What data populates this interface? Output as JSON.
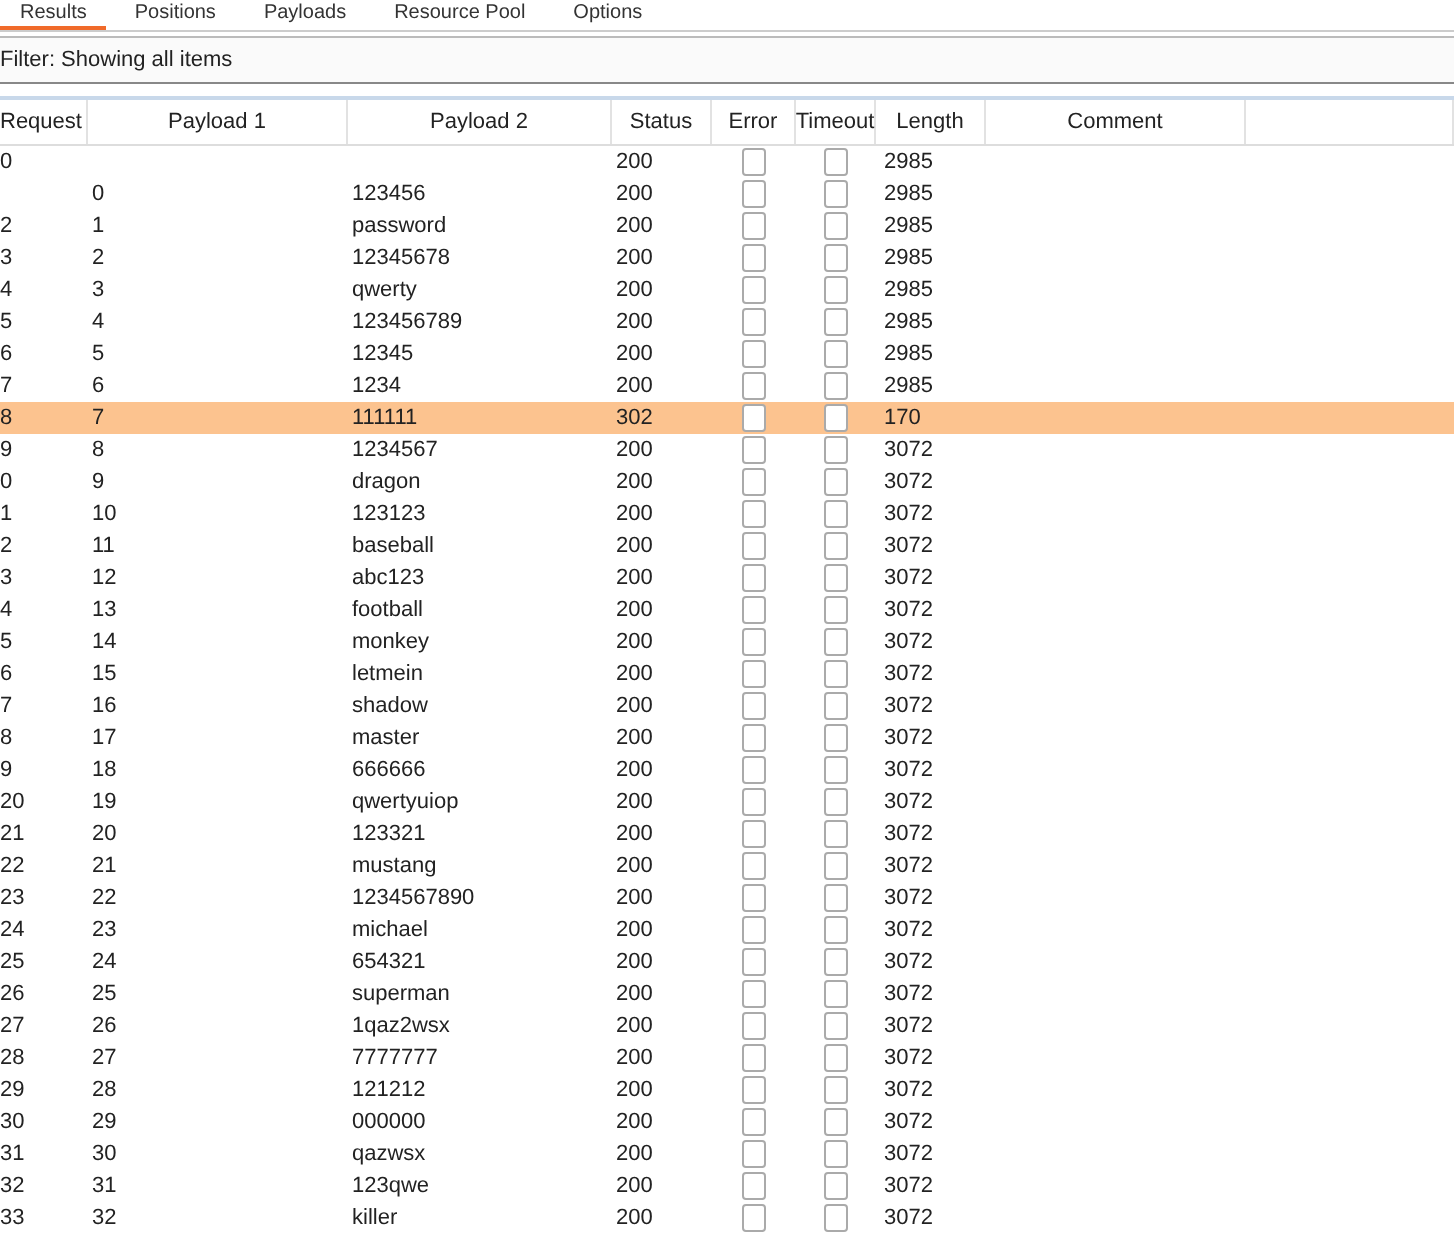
{
  "tabs": [
    {
      "label": "Results",
      "selected": true
    },
    {
      "label": "Positions",
      "selected": false
    },
    {
      "label": "Payloads",
      "selected": false
    },
    {
      "label": "Resource Pool",
      "selected": false
    },
    {
      "label": "Options",
      "selected": false
    }
  ],
  "filter": "Filter: Showing all items",
  "table": {
    "columns": [
      "Request",
      "Payload 1",
      "Payload 2",
      "Status",
      "Error",
      "Timeout",
      "Length",
      "Comment"
    ],
    "rows": [
      {
        "request": "0",
        "status": "200",
        "error": false,
        "timeout": false,
        "length": "2985",
        "selected": false
      },
      {
        "request": "",
        "payload_1": "0",
        "payload_2": "123456",
        "status": "200",
        "error": false,
        "timeout": false,
        "length": "2985",
        "selected": false
      },
      {
        "request": "2",
        "payload_1": "1",
        "payload_2": "password",
        "status": "200",
        "error": false,
        "timeout": false,
        "length": "2985",
        "selected": false
      },
      {
        "request": "3",
        "payload_1": "2",
        "payload_2": "12345678",
        "status": "200",
        "error": false,
        "timeout": false,
        "length": "2985",
        "selected": false
      },
      {
        "request": "4",
        "payload_1": "3",
        "payload_2": "qwerty",
        "status": "200",
        "error": false,
        "timeout": false,
        "length": "2985",
        "selected": false
      },
      {
        "request": "5",
        "payload_1": "4",
        "payload_2": "123456789",
        "status": "200",
        "error": false,
        "timeout": false,
        "length": "2985",
        "selected": false
      },
      {
        "request": "6",
        "payload_1": "5",
        "payload_2": "12345",
        "status": "200",
        "error": false,
        "timeout": false,
        "length": "2985",
        "selected": false
      },
      {
        "request": "7",
        "payload_1": "6",
        "payload_2": "1234",
        "status": "200",
        "error": false,
        "timeout": false,
        "length": "2985",
        "selected": false
      },
      {
        "request": "8",
        "payload_1": "7",
        "payload_2": "111111",
        "status": "302",
        "error": false,
        "timeout": false,
        "length": "170",
        "selected": true
      },
      {
        "request": "9",
        "payload_1": "8",
        "payload_2": "1234567",
        "status": "200",
        "error": false,
        "timeout": false,
        "length": "3072",
        "selected": false
      },
      {
        "request": "0",
        "payload_1": "9",
        "payload_2": "dragon",
        "status": "200",
        "error": false,
        "timeout": false,
        "length": "3072",
        "selected": false
      },
      {
        "request": "1",
        "payload_1": "10",
        "payload_2": "123123",
        "status": "200",
        "error": false,
        "timeout": false,
        "length": "3072",
        "selected": false
      },
      {
        "request": "2",
        "payload_1": "11",
        "payload_2": "baseball",
        "status": "200",
        "error": false,
        "timeout": false,
        "length": "3072",
        "selected": false
      },
      {
        "request": "3",
        "payload_1": "12",
        "payload_2": "abc123",
        "status": "200",
        "error": false,
        "timeout": false,
        "length": "3072",
        "selected": false
      },
      {
        "request": "4",
        "payload_1": "13",
        "payload_2": "football",
        "status": "200",
        "error": false,
        "timeout": false,
        "length": "3072",
        "selected": false
      },
      {
        "request": "5",
        "payload_1": "14",
        "payload_2": "monkey",
        "status": "200",
        "error": false,
        "timeout": false,
        "length": "3072",
        "selected": false
      },
      {
        "request": "6",
        "payload_1": "15",
        "payload_2": "letmein",
        "status": "200",
        "error": false,
        "timeout": false,
        "length": "3072",
        "selected": false
      },
      {
        "request": "7",
        "payload_1": "16",
        "payload_2": "shadow",
        "status": "200",
        "error": false,
        "timeout": false,
        "length": "3072",
        "selected": false
      },
      {
        "request": "8",
        "payload_1": "17",
        "payload_2": "master",
        "status": "200",
        "error": false,
        "timeout": false,
        "length": "3072",
        "selected": false
      },
      {
        "request": "9",
        "payload_1": "18",
        "payload_2": "666666",
        "status": "200",
        "error": false,
        "timeout": false,
        "length": "3072",
        "selected": false
      },
      {
        "request": "20",
        "payload_1": "19",
        "payload_2": "qwertyuiop",
        "status": "200",
        "error": false,
        "timeout": false,
        "length": "3072",
        "selected": false
      },
      {
        "request": "21",
        "payload_1": "20",
        "payload_2": "123321",
        "status": "200",
        "error": false,
        "timeout": false,
        "length": "3072",
        "selected": false
      },
      {
        "request": "22",
        "payload_1": "21",
        "payload_2": "mustang",
        "status": "200",
        "error": false,
        "timeout": false,
        "length": "3072",
        "selected": false
      },
      {
        "request": "23",
        "payload_1": "22",
        "payload_2": "1234567890",
        "status": "200",
        "error": false,
        "timeout": false,
        "length": "3072",
        "selected": false
      },
      {
        "request": "24",
        "payload_1": "23",
        "payload_2": "michael",
        "status": "200",
        "error": false,
        "timeout": false,
        "length": "3072",
        "selected": false
      },
      {
        "request": "25",
        "payload_1": "24",
        "payload_2": "654321",
        "status": "200",
        "error": false,
        "timeout": false,
        "length": "3072",
        "selected": false
      },
      {
        "request": "26",
        "payload_1": "25",
        "payload_2": "superman",
        "status": "200",
        "error": false,
        "timeout": false,
        "length": "3072",
        "selected": false
      },
      {
        "request": "27",
        "payload_1": "26",
        "payload_2": "1qaz2wsx",
        "status": "200",
        "error": false,
        "timeout": false,
        "length": "3072",
        "selected": false
      },
      {
        "request": "28",
        "payload_1": "27",
        "payload_2": "7777777",
        "status": "200",
        "error": false,
        "timeout": false,
        "length": "3072",
        "selected": false
      },
      {
        "request": "29",
        "payload_1": "28",
        "payload_2": "121212",
        "status": "200",
        "error": false,
        "timeout": false,
        "length": "3072",
        "selected": false
      },
      {
        "request": "30",
        "payload_1": "29",
        "payload_2": "000000",
        "status": "200",
        "error": false,
        "timeout": false,
        "length": "3072",
        "selected": false
      },
      {
        "request": "31",
        "payload_1": "30",
        "payload_2": "qazwsx",
        "status": "200",
        "error": false,
        "timeout": false,
        "length": "3072",
        "selected": false
      },
      {
        "request": "32",
        "payload_1": "31",
        "payload_2": "123qwe",
        "status": "200",
        "error": false,
        "timeout": false,
        "length": "3072",
        "selected": false
      },
      {
        "request": "33",
        "payload_1": "32",
        "payload_2": "killer",
        "status": "200",
        "error": false,
        "timeout": false,
        "length": "3072",
        "selected": false
      }
    ]
  }
}
